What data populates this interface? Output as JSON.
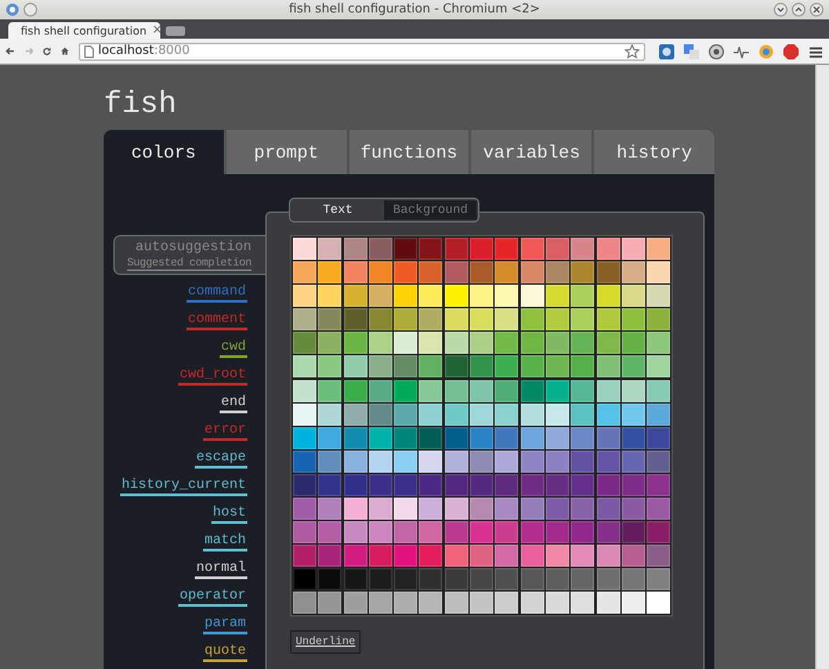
{
  "window": {
    "title": "fish shell configuration - Chromium <2>"
  },
  "browser_tab": {
    "title": "fish shell configuration",
    "close": "×"
  },
  "address_bar": {
    "host": "localhost",
    "port": ":8000"
  },
  "page": {
    "heading": "fish",
    "tabs": [
      {
        "label": "colors",
        "selected": true
      },
      {
        "label": "prompt",
        "selected": false
      },
      {
        "label": "functions",
        "selected": false
      },
      {
        "label": "variables",
        "selected": false
      },
      {
        "label": "history",
        "selected": false
      }
    ],
    "color_targets": [
      {
        "label": "autosuggestion",
        "sample": "Suggested completion",
        "color": "#8a8a8a",
        "selected": true
      },
      {
        "label": "command",
        "color": "#2f6fc5",
        "selected": false
      },
      {
        "label": "comment",
        "color": "#c82828",
        "selected": false
      },
      {
        "label": "cwd",
        "color": "#7fa52a",
        "selected": false
      },
      {
        "label": "cwd_root",
        "color": "#c82828",
        "selected": false
      },
      {
        "label": "end",
        "color": "#d0d0d0",
        "selected": false
      },
      {
        "label": "error",
        "color": "#c82828",
        "selected": false
      },
      {
        "label": "escape",
        "color": "#5fbcd3",
        "selected": false
      },
      {
        "label": "history_current",
        "color": "#5fbcd3",
        "selected": false
      },
      {
        "label": "host",
        "color": "#5fbcd3",
        "selected": false
      },
      {
        "label": "match",
        "color": "#5fbcd3",
        "selected": false
      },
      {
        "label": "normal",
        "color": "#d0d0d0",
        "selected": false
      },
      {
        "label": "operator",
        "color": "#5fbcd3",
        "selected": false
      },
      {
        "label": "param",
        "color": "#3e98d8",
        "selected": false
      },
      {
        "label": "quote",
        "color": "#c2a33a",
        "selected": false
      }
    ],
    "mode_toggle": [
      {
        "label": "Text",
        "selected": true
      },
      {
        "label": "Background",
        "selected": false
      }
    ],
    "palette": [
      [
        {
          "color": "#fbd9d9"
        },
        {
          "color": "#d5b1b3"
        },
        {
          "color": "#ad8585"
        },
        {
          "color": "#875d60"
        },
        {
          "color": "#600c0e"
        },
        {
          "color": "#861419"
        },
        {
          "color": "#b21f27"
        },
        {
          "color": "#d9202a"
        },
        {
          "color": "#e52528"
        },
        {
          "color": "#ee5958"
        },
        {
          "color": "#da5e63"
        },
        {
          "color": "#d8848b"
        },
        {
          "color": "#f08588"
        },
        {
          "color": "#f5adb1"
        },
        {
          "color": "#f8ae85"
        }
      ],
      [
        {
          "color": "#f6a65a"
        },
        {
          "color": "#f8ab20"
        },
        {
          "color": "#f28260"
        },
        {
          "color": "#f18424"
        },
        {
          "color": "#ef5b25"
        },
        {
          "color": "#d8612a"
        },
        {
          "color": "#b05a5d"
        },
        {
          "color": "#a95b2a"
        },
        {
          "color": "#d58b2a"
        },
        {
          "color": "#d68662"
        },
        {
          "color": "#ac8662"
        },
        {
          "color": "#ab8631"
        },
        {
          "color": "#875f27"
        },
        {
          "color": "#d5ae86"
        },
        {
          "color": "#fcd6af"
        }
      ],
      [
        {
          "color": "#fed482"
        },
        {
          "color": "#fdd45d"
        },
        {
          "color": "#d7b22e"
        },
        {
          "color": "#d7ae60"
        },
        {
          "color": "#fdd305"
        },
        {
          "color": "#fdec57"
        },
        {
          "color": "#fff200"
        },
        {
          "color": "#fff383"
        },
        {
          "color": "#fff9b2"
        },
        {
          "color": "#fff9d9"
        },
        {
          "color": "#d7d92d"
        },
        {
          "color": "#acd05c"
        },
        {
          "color": "#d6da28"
        },
        {
          "color": "#d8d989"
        },
        {
          "color": "#d6d8b2"
        }
      ],
      [
        {
          "color": "#afae8b"
        },
        {
          "color": "#87875c"
        },
        {
          "color": "#5f5e2a"
        },
        {
          "color": "#858830"
        },
        {
          "color": "#acad35"
        },
        {
          "color": "#aeae60"
        },
        {
          "color": "#d9db5e"
        },
        {
          "color": "#d8df5c"
        },
        {
          "color": "#d9e086"
        },
        {
          "color": "#8dc13f"
        },
        {
          "color": "#afcd3e"
        },
        {
          "color": "#acd05d"
        },
        {
          "color": "#aec93a"
        },
        {
          "color": "#8dc03f"
        },
        {
          "color": "#8bb23c"
        }
      ],
      [
        {
          "color": "#658b3c"
        },
        {
          "color": "#8bb060"
        },
        {
          "color": "#6ab545"
        },
        {
          "color": "#add28a"
        },
        {
          "color": "#dbecd3"
        },
        {
          "color": "#d9e4ae"
        },
        {
          "color": "#b9dba8"
        },
        {
          "color": "#acd088"
        },
        {
          "color": "#73b947"
        },
        {
          "color": "#72b547"
        },
        {
          "color": "#80b962"
        },
        {
          "color": "#64b456"
        },
        {
          "color": "#80b94a"
        },
        {
          "color": "#66b145"
        },
        {
          "color": "#8dc77b"
        }
      ],
      [
        {
          "color": "#acd8ae"
        },
        {
          "color": "#8ac983"
        },
        {
          "color": "#93ccac"
        },
        {
          "color": "#89ae88"
        },
        {
          "color": "#648b62"
        },
        {
          "color": "#61b05f"
        },
        {
          "color": "#206436"
        },
        {
          "color": "#32924c"
        },
        {
          "color": "#3eb04f"
        },
        {
          "color": "#5ab34a"
        },
        {
          "color": "#6db650"
        },
        {
          "color": "#54b04a"
        },
        {
          "color": "#80c178"
        },
        {
          "color": "#5fb66b"
        },
        {
          "color": "#a1d39e"
        }
      ],
      [
        {
          "color": "#c2e2ce"
        },
        {
          "color": "#6cbe7c"
        },
        {
          "color": "#39ad49"
        },
        {
          "color": "#5baa86"
        },
        {
          "color": "#00aa57"
        },
        {
          "color": "#87c996"
        },
        {
          "color": "#74c092"
        },
        {
          "color": "#7dc4a9"
        },
        {
          "color": "#4eae74"
        },
        {
          "color": "#018a63"
        },
        {
          "color": "#05b28d"
        },
        {
          "color": "#53b898"
        },
        {
          "color": "#9bd1bd"
        },
        {
          "color": "#acd7bf"
        },
        {
          "color": "#86cab5"
        }
      ],
      [
        {
          "color": "#e8f4f4"
        },
        {
          "color": "#afd7d6"
        },
        {
          "color": "#8eadab"
        },
        {
          "color": "#628a89"
        },
        {
          "color": "#5ca9ab"
        },
        {
          "color": "#8ed0d4"
        },
        {
          "color": "#6ec9c8"
        },
        {
          "color": "#9fd8d9"
        },
        {
          "color": "#8bd1cd"
        },
        {
          "color": "#b4dede"
        },
        {
          "color": "#c6e8eb"
        },
        {
          "color": "#5bc2c0"
        },
        {
          "color": "#55c2e7"
        },
        {
          "color": "#6fc7ee"
        },
        {
          "color": "#5ca8d8"
        }
      ],
      [
        {
          "color": "#00b4dd"
        },
        {
          "color": "#3ea9e0"
        },
        {
          "color": "#0f8cae"
        },
        {
          "color": "#00b2ac"
        },
        {
          "color": "#00877c"
        },
        {
          "color": "#015e56"
        },
        {
          "color": "#015e8c"
        },
        {
          "color": "#2b83c6"
        },
        {
          "color": "#4377bb"
        },
        {
          "color": "#6ca5db"
        },
        {
          "color": "#90a9db"
        },
        {
          "color": "#6a87c6"
        },
        {
          "color": "#6874b7"
        },
        {
          "color": "#3250a0"
        },
        {
          "color": "#3d489c"
        }
      ],
      [
        {
          "color": "#1565b0"
        },
        {
          "color": "#608ebb"
        },
        {
          "color": "#8ab0dd"
        },
        {
          "color": "#b4d4f0"
        },
        {
          "color": "#89cff1"
        },
        {
          "color": "#d5d7ee"
        },
        {
          "color": "#b0b0dc"
        },
        {
          "color": "#8b8bb3"
        },
        {
          "color": "#adaadb"
        },
        {
          "color": "#8c84c3"
        },
        {
          "color": "#8b81c3"
        },
        {
          "color": "#6451a3"
        },
        {
          "color": "#6654a7"
        },
        {
          "color": "#6565b0"
        },
        {
          "color": "#636090"
        }
      ],
      [
        {
          "color": "#2b2a6c"
        },
        {
          "color": "#32328a"
        },
        {
          "color": "#312f8c"
        },
        {
          "color": "#3c2f88"
        },
        {
          "color": "#392e89"
        },
        {
          "color": "#4b2883"
        },
        {
          "color": "#53277f"
        },
        {
          "color": "#532a80"
        },
        {
          "color": "#5d2a7f"
        },
        {
          "color": "#6d2c85"
        },
        {
          "color": "#652d84"
        },
        {
          "color": "#62308a"
        },
        {
          "color": "#7c2a8a"
        },
        {
          "color": "#7f2c89"
        },
        {
          "color": "#8c328d"
        }
      ],
      [
        {
          "color": "#a15ca8"
        },
        {
          "color": "#b17fbc"
        },
        {
          "color": "#f4b0d4"
        },
        {
          "color": "#dcacd2"
        },
        {
          "color": "#f1d9ea"
        },
        {
          "color": "#c9b1d9"
        },
        {
          "color": "#d9b1d4"
        },
        {
          "color": "#b689b3"
        },
        {
          "color": "#a58bc2"
        },
        {
          "color": "#957fba"
        },
        {
          "color": "#7b5ba5"
        },
        {
          "color": "#8662a8"
        },
        {
          "color": "#7859a5"
        },
        {
          "color": "#8a5ba2"
        },
        {
          "color": "#9c5aa4"
        }
      ],
      [
        {
          "color": "#ad5ba2"
        },
        {
          "color": "#b55da6"
        },
        {
          "color": "#c58ac0"
        },
        {
          "color": "#cd87bf"
        },
        {
          "color": "#c166a4"
        },
        {
          "color": "#d066a3"
        },
        {
          "color": "#b83a91"
        },
        {
          "color": "#d93292"
        },
        {
          "color": "#cd3d8f"
        },
        {
          "color": "#b32d8d"
        },
        {
          "color": "#a02b8b"
        },
        {
          "color": "#92278c"
        },
        {
          "color": "#862f8b"
        },
        {
          "color": "#631c5e"
        },
        {
          "color": "#891e67"
        }
      ],
      [
        {
          "color": "#b21f6a"
        },
        {
          "color": "#a9237a"
        },
        {
          "color": "#d11d82"
        },
        {
          "color": "#d81c60"
        },
        {
          "color": "#e2127e"
        },
        {
          "color": "#e61d5b"
        },
        {
          "color": "#f0637b"
        },
        {
          "color": "#e06283"
        },
        {
          "color": "#d16aa4"
        },
        {
          "color": "#e8609b"
        },
        {
          "color": "#f087a5"
        },
        {
          "color": "#e48ab8"
        },
        {
          "color": "#da89b3"
        },
        {
          "color": "#b65e8f"
        },
        {
          "color": "#8b5e89"
        }
      ],
      [
        {
          "color": "#010101"
        },
        {
          "color": "#0b0b0b"
        },
        {
          "color": "#171717"
        },
        {
          "color": "#1c1c1c"
        },
        {
          "color": "#212121"
        },
        {
          "color": "#303030"
        },
        {
          "color": "#3b3b3b"
        },
        {
          "color": "#464646"
        },
        {
          "color": "#4f4f4f"
        },
        {
          "color": "#575757"
        },
        {
          "color": "#5e5e5e"
        },
        {
          "color": "#666666"
        },
        {
          "color": "#6f6f6f"
        },
        {
          "color": "#767676"
        },
        {
          "color": "#808080"
        }
      ],
      [
        {
          "color": "#8f8f8f"
        },
        {
          "color": "#959595"
        },
        {
          "color": "#9e9e9e"
        },
        {
          "color": "#a6a6a6"
        },
        {
          "color": "#adadad"
        },
        {
          "color": "#b5b5b5"
        },
        {
          "color": "#bdbdbd"
        },
        {
          "color": "#c4c4c4"
        },
        {
          "color": "#cccccc"
        },
        {
          "color": "#d3d3d3"
        },
        {
          "color": "#dadada"
        },
        {
          "color": "#dedede"
        },
        {
          "color": "#e5e5e5"
        },
        {
          "color": "#ededed"
        },
        {
          "color": "#ffffff"
        }
      ]
    ],
    "underline_button": "Underline"
  }
}
